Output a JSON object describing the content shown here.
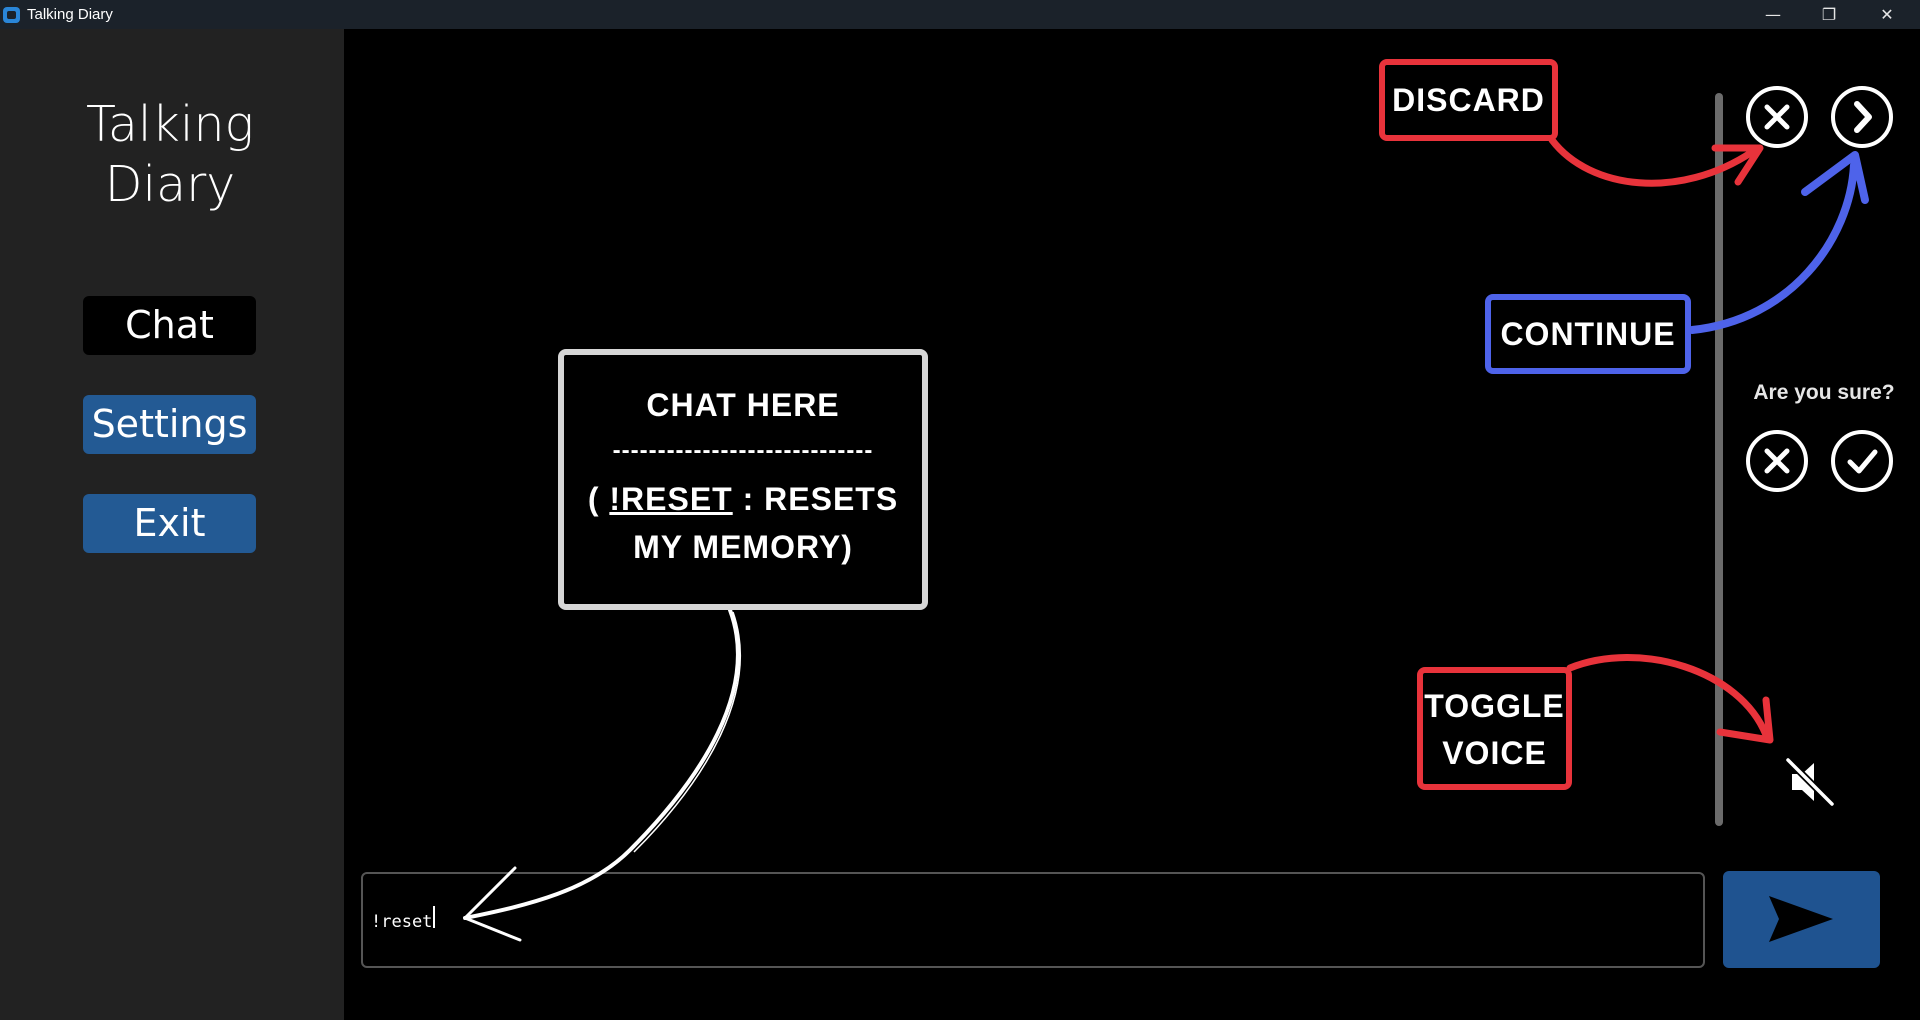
{
  "window": {
    "title": "Talking Diary",
    "minimize_label": "—",
    "restore_label": "❐",
    "close_label": "✕"
  },
  "sidebar": {
    "app_name": "Talking Diary",
    "items": [
      {
        "label": "Chat"
      },
      {
        "label": "Settings"
      },
      {
        "label": "Exit"
      }
    ]
  },
  "chat": {
    "input_value": "!reset",
    "confirm_prompt": "Are you sure?"
  },
  "annotations": {
    "discard": "DISCARD",
    "continue": "CONTINUE",
    "toggle_voice_line1": "TOGGLE",
    "toggle_voice_line2": "VOICE",
    "chat_here_title": "CHAT HERE",
    "chat_here_divider": "-----------------------------",
    "chat_here_open": "( ",
    "chat_here_command": "!RESET",
    "chat_here_rest": " : RESETS MY MEMORY)"
  },
  "colors": {
    "nav_active_bg": "#000000",
    "nav_button_bg": "#235a94",
    "send_button_bg": "#1f5390",
    "annotation_red": "#e8333b",
    "annotation_blue": "#4e63ea",
    "annotation_grey": "#d6d6d6"
  },
  "icons": {
    "discard": "x-circle-icon",
    "continue": "chevron-right-circle-icon",
    "cancel": "x-circle-icon",
    "confirm": "check-circle-icon",
    "voice": "speaker-muted-icon",
    "send": "send-icon"
  }
}
